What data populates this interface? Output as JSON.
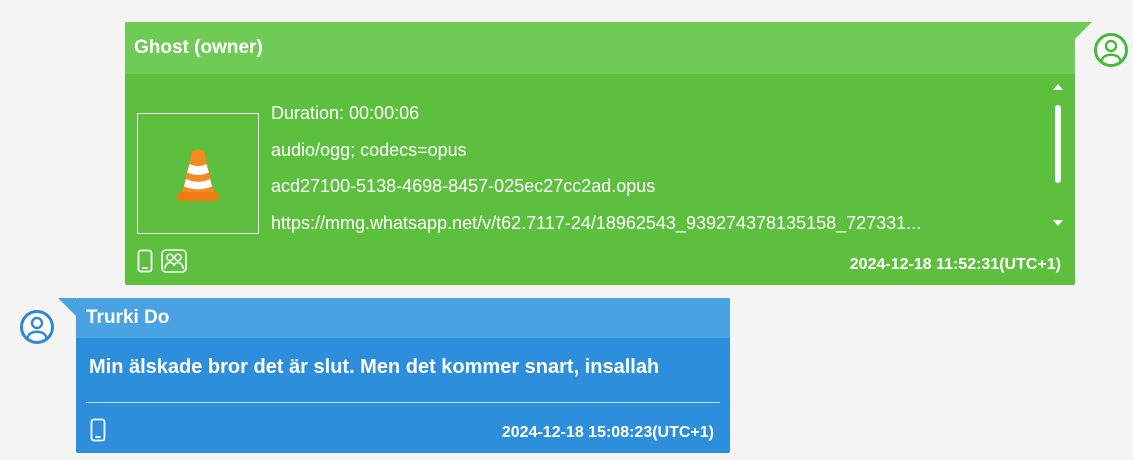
{
  "owner_message": {
    "sender": "Ghost (owner)",
    "attachment": {
      "thumbnail_icon": "vlc-cone-icon",
      "duration": "Duration: 00:00:06",
      "mime_type": "audio/ogg; codecs=opus",
      "filename": "acd27100-5138-4698-8457-025ec27cc2ad.opus",
      "url": "https://mmg.whatsapp.net/v/t62.7117-24/18962543_939274378135158_727331..."
    },
    "footer_icons": [
      "phone-icon",
      "group-icon"
    ],
    "timestamp": "2024-12-18 11:52:31(UTC+1)",
    "avatar_icon": "user-icon"
  },
  "contact_message": {
    "sender": "Trurki Do",
    "text": "Min älskade bror det är slut. Men det kommer snart,  insallah",
    "footer_icons": [
      "phone-icon"
    ],
    "timestamp": "2024-12-18 15:08:23(UTC+1)",
    "avatar_icon": "user-icon"
  },
  "colors": {
    "background": "#f4f4f4",
    "owner_bubble": "#5dbf3e",
    "owner_header": "#6fcb56",
    "contact_bubble": "#2d8fdc",
    "contact_header": "#49a3e3",
    "text": "#ffffff"
  }
}
